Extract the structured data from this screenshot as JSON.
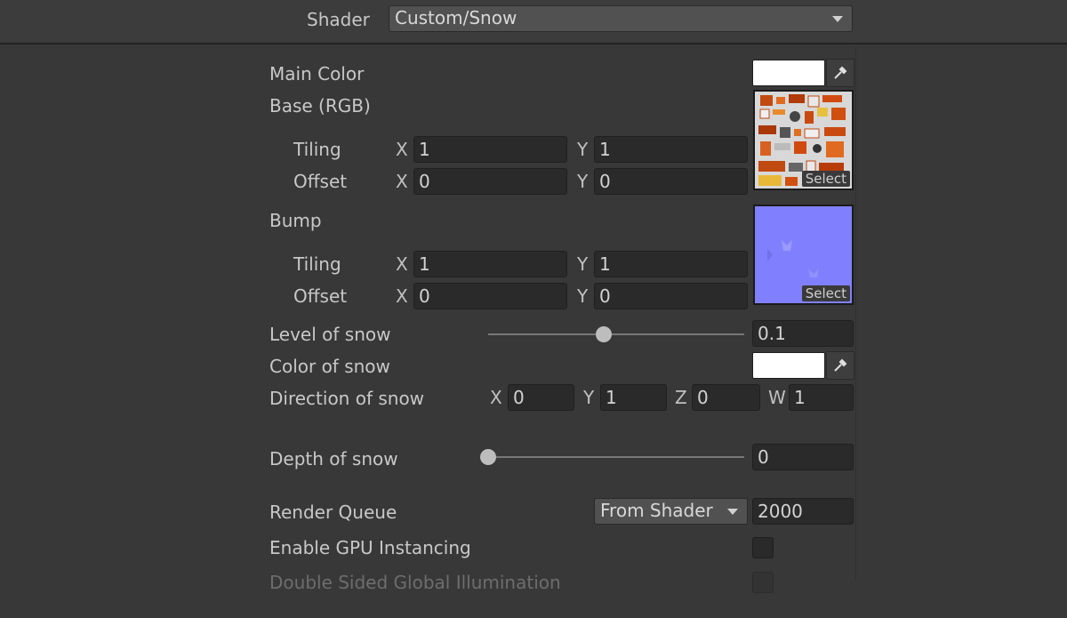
{
  "shader": {
    "label": "Shader",
    "value": "Custom/Snow"
  },
  "main_color": {
    "label": "Main Color",
    "swatch": "#ffffff"
  },
  "base": {
    "label": "Base (RGB)",
    "tiling": {
      "label": "Tiling",
      "x_axis": "X",
      "x": "1",
      "y_axis": "Y",
      "y": "1"
    },
    "offset": {
      "label": "Offset",
      "x_axis": "X",
      "x": "0",
      "y_axis": "Y",
      "y": "0"
    },
    "select": "Select"
  },
  "bump": {
    "label": "Bump",
    "tiling": {
      "label": "Tiling",
      "x_axis": "X",
      "x": "1",
      "y_axis": "Y",
      "y": "1"
    },
    "offset": {
      "label": "Offset",
      "x_axis": "X",
      "x": "0",
      "y_axis": "Y",
      "y": "0"
    },
    "select": "Select"
  },
  "level_of_snow": {
    "label": "Level of snow",
    "value": "0.1",
    "fraction": 0.1
  },
  "color_of_snow": {
    "label": "Color of snow",
    "swatch": "#ffffff"
  },
  "direction_of_snow": {
    "label": "Direction of snow",
    "x_axis": "X",
    "x": "0",
    "y_axis": "Y",
    "y": "1",
    "z_axis": "Z",
    "z": "0",
    "w_axis": "W",
    "w": "1"
  },
  "depth_of_snow": {
    "label": "Depth of snow",
    "value": "0",
    "fraction": 0
  },
  "render_queue": {
    "label": "Render Queue",
    "mode": "From Shader",
    "value": "2000"
  },
  "gpu_instancing": {
    "label": "Enable GPU Instancing",
    "checked": false
  },
  "double_sided_gi": {
    "label": "Double Sided Global Illumination",
    "checked": false,
    "enabled": false
  }
}
